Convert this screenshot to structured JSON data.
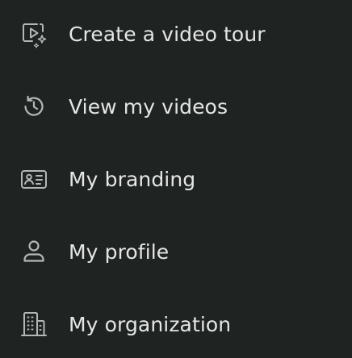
{
  "menu": {
    "items": [
      {
        "label": "Create a video tour",
        "icon": "video-sparkle-icon"
      },
      {
        "label": "View my videos",
        "icon": "history-icon"
      },
      {
        "label": "My branding",
        "icon": "id-card-icon"
      },
      {
        "label": "My profile",
        "icon": "user-icon"
      },
      {
        "label": "My organization",
        "icon": "building-icon"
      }
    ]
  },
  "colors": {
    "background": "#1f2322",
    "text": "#e4e7e5",
    "icon": "#b3b8b6"
  }
}
